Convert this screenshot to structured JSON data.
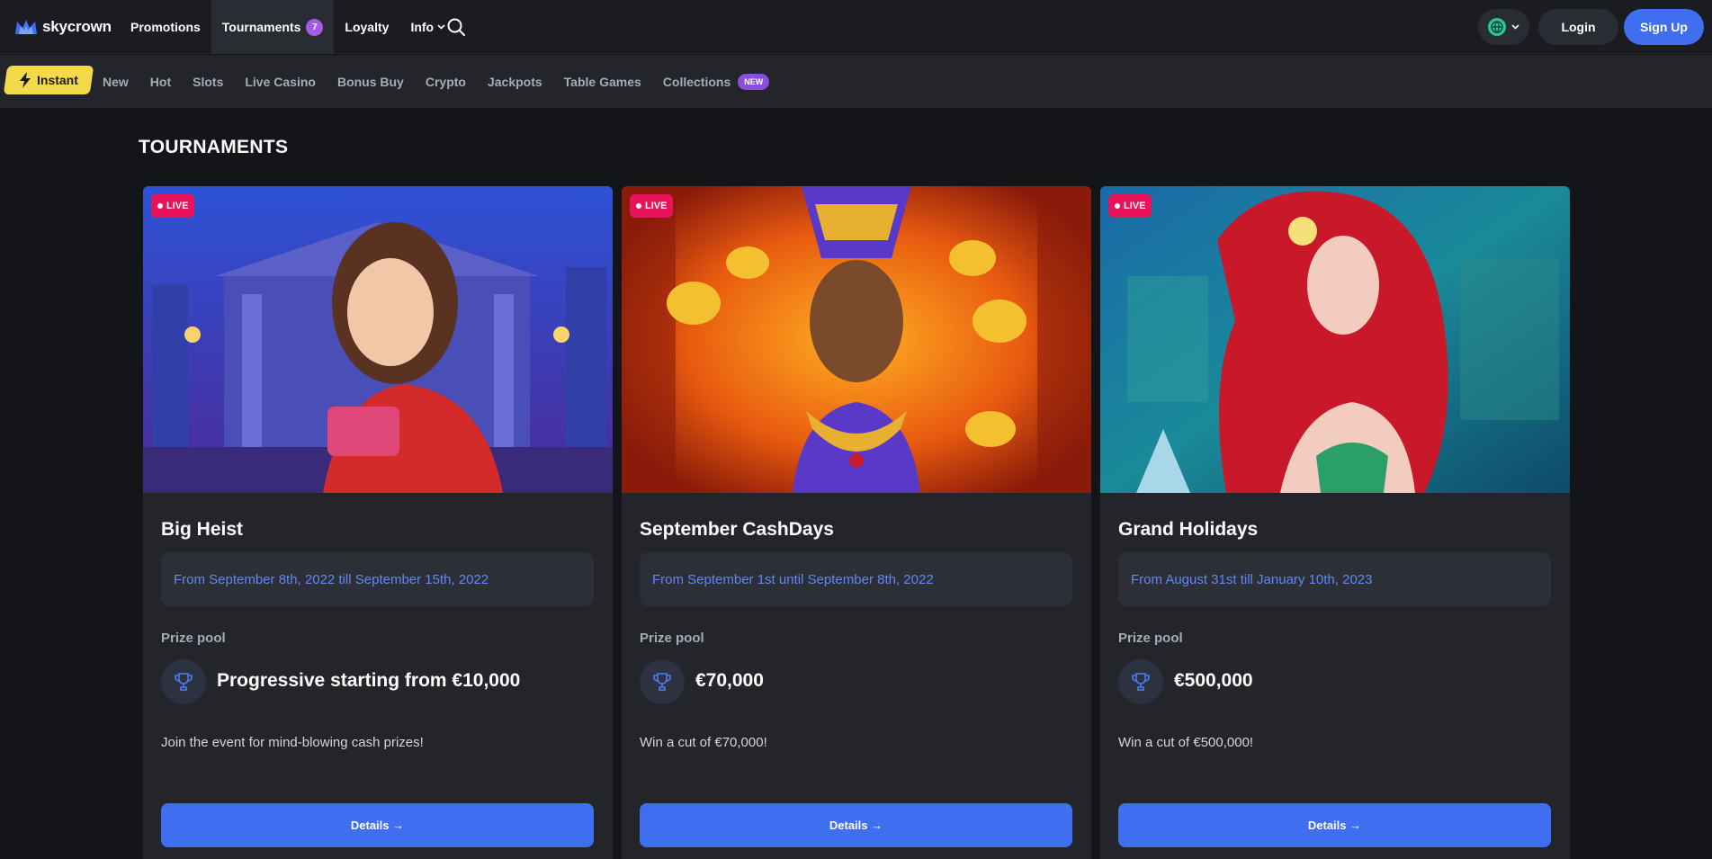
{
  "brand": {
    "name": "skycrown",
    "accent": "#3f6ff0"
  },
  "topnav": {
    "promotions": "Promotions",
    "tournaments": "Tournaments",
    "tournaments_count": "7",
    "loyalty": "Loyalty",
    "info": "Info"
  },
  "header_actions": {
    "login": "Login",
    "signup": "Sign Up",
    "lang_icon": "globe-icon"
  },
  "categories": {
    "instant": "Instant",
    "items": [
      "New",
      "Hot",
      "Slots",
      "Live Casino",
      "Bonus Buy",
      "Crypto",
      "Jackpots",
      "Table Games",
      "Collections"
    ],
    "collections_badge": "NEW"
  },
  "page": {
    "title": "TOURNAMENTS"
  },
  "tournaments": [
    {
      "status": "LIVE",
      "title": "Big Heist",
      "dates": "From September 8th, 2022 till September 15th, 2022",
      "prize_label": "Prize pool",
      "prize": "Progressive starting from €10,000",
      "description": "Join the event for mind-blowing cash prizes!",
      "button": "Details →"
    },
    {
      "status": "LIVE",
      "title": "September CashDays",
      "dates": "From September 1st until September 8th, 2022",
      "prize_label": "Prize pool",
      "prize": "€70,000",
      "description": "Win a cut of €70,000!",
      "button": "Details →"
    },
    {
      "status": "LIVE",
      "title": "Grand Holidays",
      "dates": "From August 31st till January 10th, 2023",
      "prize_label": "Prize pool",
      "prize": "€500,000",
      "description": "Win a cut of €500,000!",
      "button": "Details →"
    }
  ]
}
